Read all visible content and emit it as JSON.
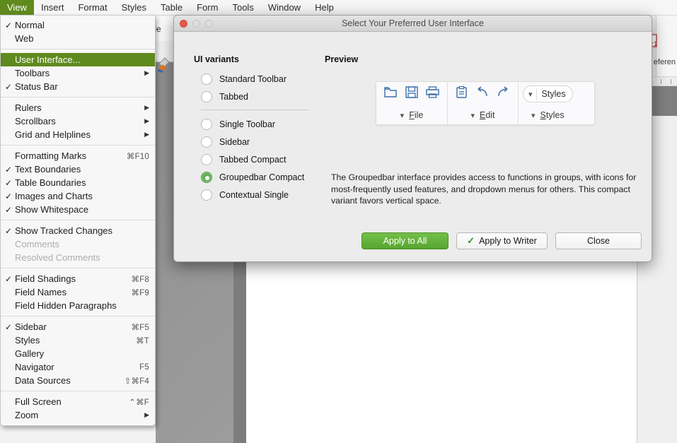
{
  "menubar": {
    "items": [
      {
        "label": "View",
        "active": true
      },
      {
        "label": "Insert",
        "active": false
      },
      {
        "label": "Format",
        "active": false
      },
      {
        "label": "Styles",
        "active": false
      },
      {
        "label": "Table",
        "active": false
      },
      {
        "label": "Form",
        "active": false
      },
      {
        "label": "Tools",
        "active": false
      },
      {
        "label": "Window",
        "active": false
      },
      {
        "label": "Help",
        "active": false
      }
    ]
  },
  "view_menu": {
    "groups": [
      [
        {
          "label": "Normal",
          "checked": true,
          "accel": "",
          "submenu": false,
          "selected": false,
          "disabled": false
        },
        {
          "label": "Web",
          "checked": false,
          "accel": "",
          "submenu": false,
          "selected": false,
          "disabled": false
        }
      ],
      [
        {
          "label": "User Interface...",
          "checked": false,
          "accel": "",
          "submenu": false,
          "selected": true,
          "disabled": false
        },
        {
          "label": "Toolbars",
          "checked": false,
          "accel": "",
          "submenu": true,
          "selected": false,
          "disabled": false
        },
        {
          "label": "Status Bar",
          "checked": true,
          "accel": "",
          "submenu": false,
          "selected": false,
          "disabled": false
        }
      ],
      [
        {
          "label": "Rulers",
          "checked": false,
          "accel": "",
          "submenu": true,
          "selected": false,
          "disabled": false
        },
        {
          "label": "Scrollbars",
          "checked": false,
          "accel": "",
          "submenu": true,
          "selected": false,
          "disabled": false
        },
        {
          "label": "Grid and Helplines",
          "checked": false,
          "accel": "",
          "submenu": true,
          "selected": false,
          "disabled": false
        }
      ],
      [
        {
          "label": "Formatting Marks",
          "checked": false,
          "accel": "⌘F10",
          "submenu": false,
          "selected": false,
          "disabled": false
        },
        {
          "label": "Text Boundaries",
          "checked": true,
          "accel": "",
          "submenu": false,
          "selected": false,
          "disabled": false
        },
        {
          "label": "Table Boundaries",
          "checked": true,
          "accel": "",
          "submenu": false,
          "selected": false,
          "disabled": false
        },
        {
          "label": "Images and Charts",
          "checked": true,
          "accel": "",
          "submenu": false,
          "selected": false,
          "disabled": false
        },
        {
          "label": "Show Whitespace",
          "checked": true,
          "accel": "",
          "submenu": false,
          "selected": false,
          "disabled": false
        }
      ],
      [
        {
          "label": "Show Tracked Changes",
          "checked": true,
          "accel": "",
          "submenu": false,
          "selected": false,
          "disabled": false
        },
        {
          "label": "Comments",
          "checked": false,
          "accel": "",
          "submenu": false,
          "selected": false,
          "disabled": true
        },
        {
          "label": "Resolved Comments",
          "checked": false,
          "accel": "",
          "submenu": false,
          "selected": false,
          "disabled": true
        }
      ],
      [
        {
          "label": "Field Shadings",
          "checked": true,
          "accel": "⌘F8",
          "submenu": false,
          "selected": false,
          "disabled": false
        },
        {
          "label": "Field Names",
          "checked": false,
          "accel": "⌘F9",
          "submenu": false,
          "selected": false,
          "disabled": false
        },
        {
          "label": "Field Hidden Paragraphs",
          "checked": false,
          "accel": "",
          "submenu": false,
          "selected": false,
          "disabled": false
        }
      ],
      [
        {
          "label": "Sidebar",
          "checked": true,
          "accel": "⌘F5",
          "submenu": false,
          "selected": false,
          "disabled": false
        },
        {
          "label": "Styles",
          "checked": false,
          "accel": "⌘T",
          "submenu": false,
          "selected": false,
          "disabled": false
        },
        {
          "label": "Gallery",
          "checked": false,
          "accel": "",
          "submenu": false,
          "selected": false,
          "disabled": false
        },
        {
          "label": "Navigator",
          "checked": false,
          "accel": "F5",
          "submenu": false,
          "selected": false,
          "disabled": false
        },
        {
          "label": "Data Sources",
          "checked": false,
          "accel": "⇧⌘F4",
          "submenu": false,
          "selected": false,
          "disabled": false
        }
      ],
      [
        {
          "label": "Full Screen",
          "checked": false,
          "accel": "⌃⌘F",
          "submenu": false,
          "selected": false,
          "disabled": false
        },
        {
          "label": "Zoom",
          "checked": false,
          "accel": "",
          "submenu": true,
          "selected": false,
          "disabled": false
        }
      ]
    ]
  },
  "dialog": {
    "title": "Select Your Preferred User Interface",
    "ui_variants_heading": "UI variants",
    "preview_heading": "Preview",
    "variants": [
      {
        "label": "Standard Toolbar",
        "selected": false
      },
      {
        "label": "Tabbed",
        "selected": false
      },
      {
        "label": "Single Toolbar",
        "selected": false
      },
      {
        "label": "Sidebar",
        "selected": false
      },
      {
        "label": "Tabbed Compact",
        "selected": false
      },
      {
        "label": "Groupedbar Compact",
        "selected": true
      },
      {
        "label": "Contextual Single",
        "selected": false
      }
    ],
    "description": "The Groupedbar interface provides access to functions in groups, with icons for most-frequently used features, and dropdown menus for others. This compact variant favors vertical space.",
    "preview": {
      "groups": [
        {
          "name": "File",
          "icons": [
            "new-document-icon",
            "save-icon",
            "print-icon"
          ]
        },
        {
          "name": "Edit",
          "icons": [
            "paste-icon",
            "undo-icon",
            "redo-icon"
          ]
        },
        {
          "name": "Styles",
          "icons": [],
          "button_label": "Styles"
        }
      ]
    },
    "buttons": {
      "apply_all": "Apply to All",
      "apply_writer": "Apply to Writer",
      "close": "Close"
    }
  },
  "background": {
    "style_cell_text": "tyle",
    "sidebar_label": "eferen"
  }
}
